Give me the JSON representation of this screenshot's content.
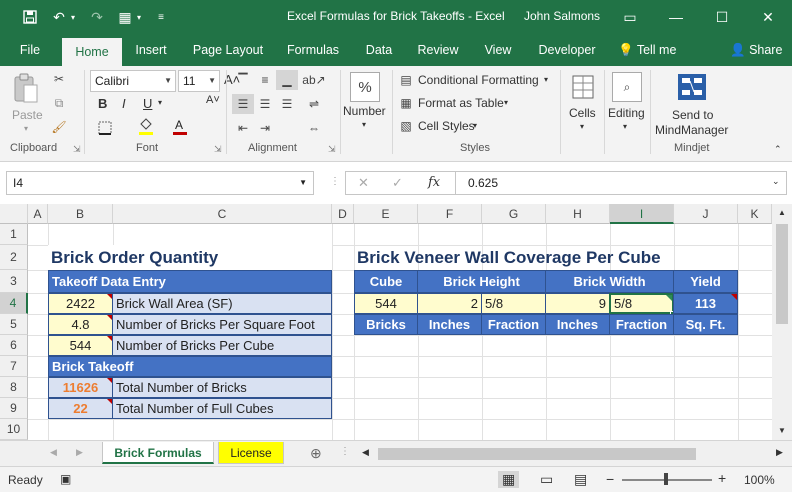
{
  "titlebar": {
    "title": "Excel Formulas for Brick Takeoffs  -  Excel",
    "user": "John Salmons",
    "icons": [
      "save-icon",
      "undo-icon",
      "redo-icon",
      "form-icon",
      "customize-icon"
    ],
    "buttons": [
      "ribbon-display-icon",
      "minimize-icon",
      "maximize-icon",
      "close-icon"
    ]
  },
  "tabs": [
    "File",
    "Home",
    "Insert",
    "Page Layout",
    "Formulas",
    "Data",
    "Review",
    "View",
    "Developer",
    "Tell me",
    "Share"
  ],
  "ribbon": {
    "clipboard": {
      "paste": "Paste",
      "label": "Clipboard"
    },
    "font": {
      "name": "Calibri",
      "size": "11",
      "label": "Font",
      "bold": "B",
      "italic": "I",
      "underline": "U",
      "grow": "A˄",
      "shrink": "A˅",
      "color": "A"
    },
    "alignment": {
      "label": "Alignment"
    },
    "number": {
      "label": "Number",
      "icon": "%"
    },
    "styles": {
      "conditional": "Conditional Formatting",
      "table": "Format as Table",
      "cell": "Cell Styles",
      "label": "Styles"
    },
    "cells": {
      "label": "Cells"
    },
    "editing": {
      "label": "Editing"
    },
    "mindjet": {
      "send_line1": "Send to",
      "send_line2": "MindManager",
      "label": "Mindjet"
    }
  },
  "formula_bar": {
    "name_box": "I4",
    "fx": "fx",
    "value": "0.625"
  },
  "columns": [
    "A",
    "B",
    "C",
    "D",
    "E",
    "F",
    "G",
    "H",
    "I",
    "J",
    "K"
  ],
  "rows": [
    "1",
    "2",
    "3",
    "4",
    "5",
    "6",
    "7",
    "8",
    "9",
    "10"
  ],
  "sheet": {
    "left_title": "Brick Order Quantity",
    "right_title": "Brick Veneer Wall Coverage Per Cube",
    "takeoff_entry": "Takeoff Data Entry",
    "entries": [
      {
        "value": "2422",
        "label": "Brick Wall Area (SF)"
      },
      {
        "value": "4.8",
        "label": "Number of Bricks Per Square Foot"
      },
      {
        "value": "544",
        "label": "Number of Bricks Per Cube"
      }
    ],
    "brick_takeoff": "Brick Takeoff",
    "results": [
      {
        "value": "11626",
        "label": "Total Number of Bricks"
      },
      {
        "value": "22",
        "label": "Total Number of Full Cubes"
      }
    ],
    "coverage": {
      "headers": [
        "Cube",
        "Brick Height",
        "Brick Width",
        "Yield"
      ],
      "values": [
        "544",
        "2",
        "5/8",
        "9",
        "5/8",
        "113"
      ],
      "units": [
        "Bricks",
        "Inches",
        "Fraction",
        "Inches",
        "Fraction",
        "Sq. Ft."
      ]
    }
  },
  "sheet_tabs": [
    "Brick Formulas",
    "License"
  ],
  "status": {
    "ready": "Ready",
    "zoom": "100%"
  }
}
